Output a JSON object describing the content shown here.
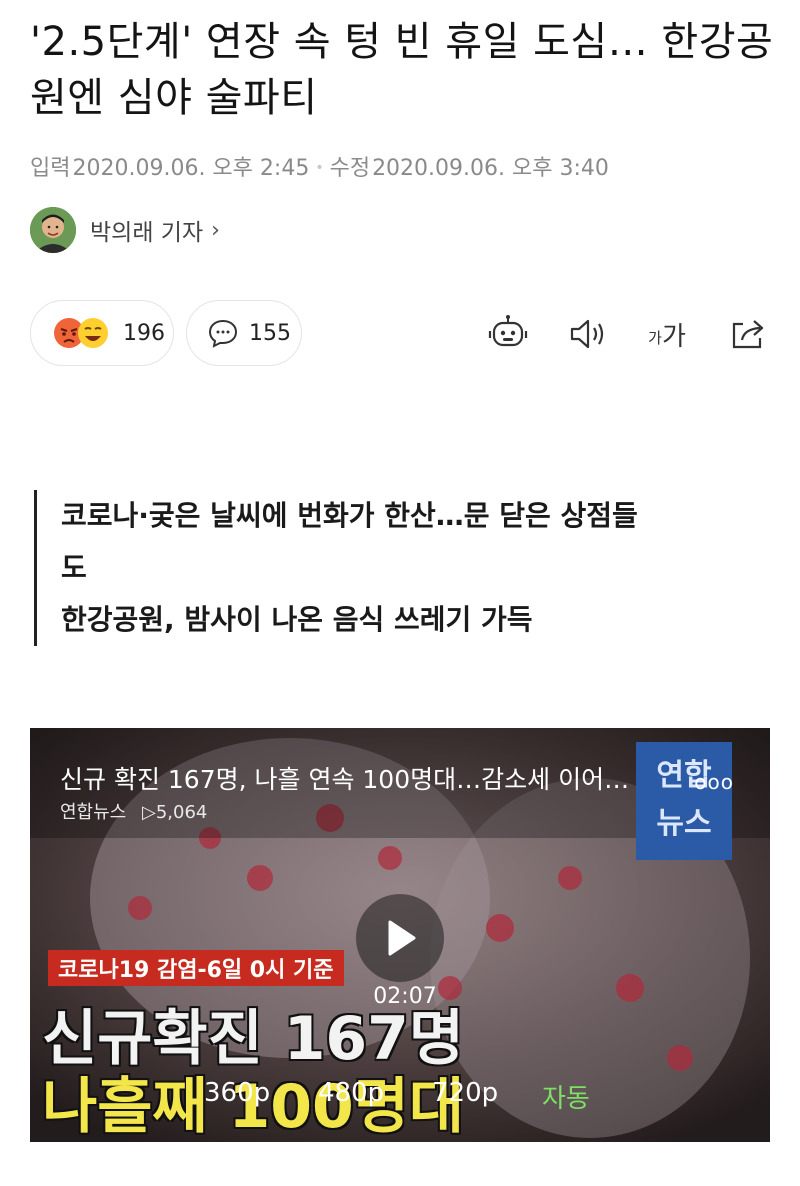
{
  "article": {
    "title": "'2.5단계' 연장 속 텅 빈 휴일 도심… 한강공원엔 심야 술파티",
    "input_label": "입력",
    "input_time": "2020.09.06. 오후 2:45",
    "edit_label": "수정",
    "edit_time": "2020.09.06. 오후 3:40",
    "reporter": "박의래 기자"
  },
  "actions": {
    "reactions_count": "196",
    "comments_count": "155",
    "font_size_label_small": "가",
    "font_size_label_large": "가"
  },
  "summary": [
    "코로나·궂은 날씨에 번화가 한산…문 닫은 상점들",
    "도",
    "한강공원, 밤사이 나온 음식 쓰레기 가득"
  ],
  "video": {
    "title": "신규 확진 167명, 나흘 연속 100명대…감소세 이어…",
    "channel": "연합뉴스",
    "views": "5,064",
    "more": "ooo",
    "logo_line1": "연합",
    "logo_line2": "뉴스",
    "duration": "02:07",
    "caption_box": "코로나19 감염-6일 0시 기준",
    "caption_big1": "신규확진 167명",
    "caption_big2": "나흘째 100명대",
    "quality_options": [
      "360p",
      "480p",
      "720p",
      "자동"
    ]
  },
  "colors": {
    "accent_green": "#7ddf64",
    "caption_red": "#c72a1e",
    "caption_yellow": "#f3e64a",
    "logo_blue": "#2b5aa6"
  }
}
